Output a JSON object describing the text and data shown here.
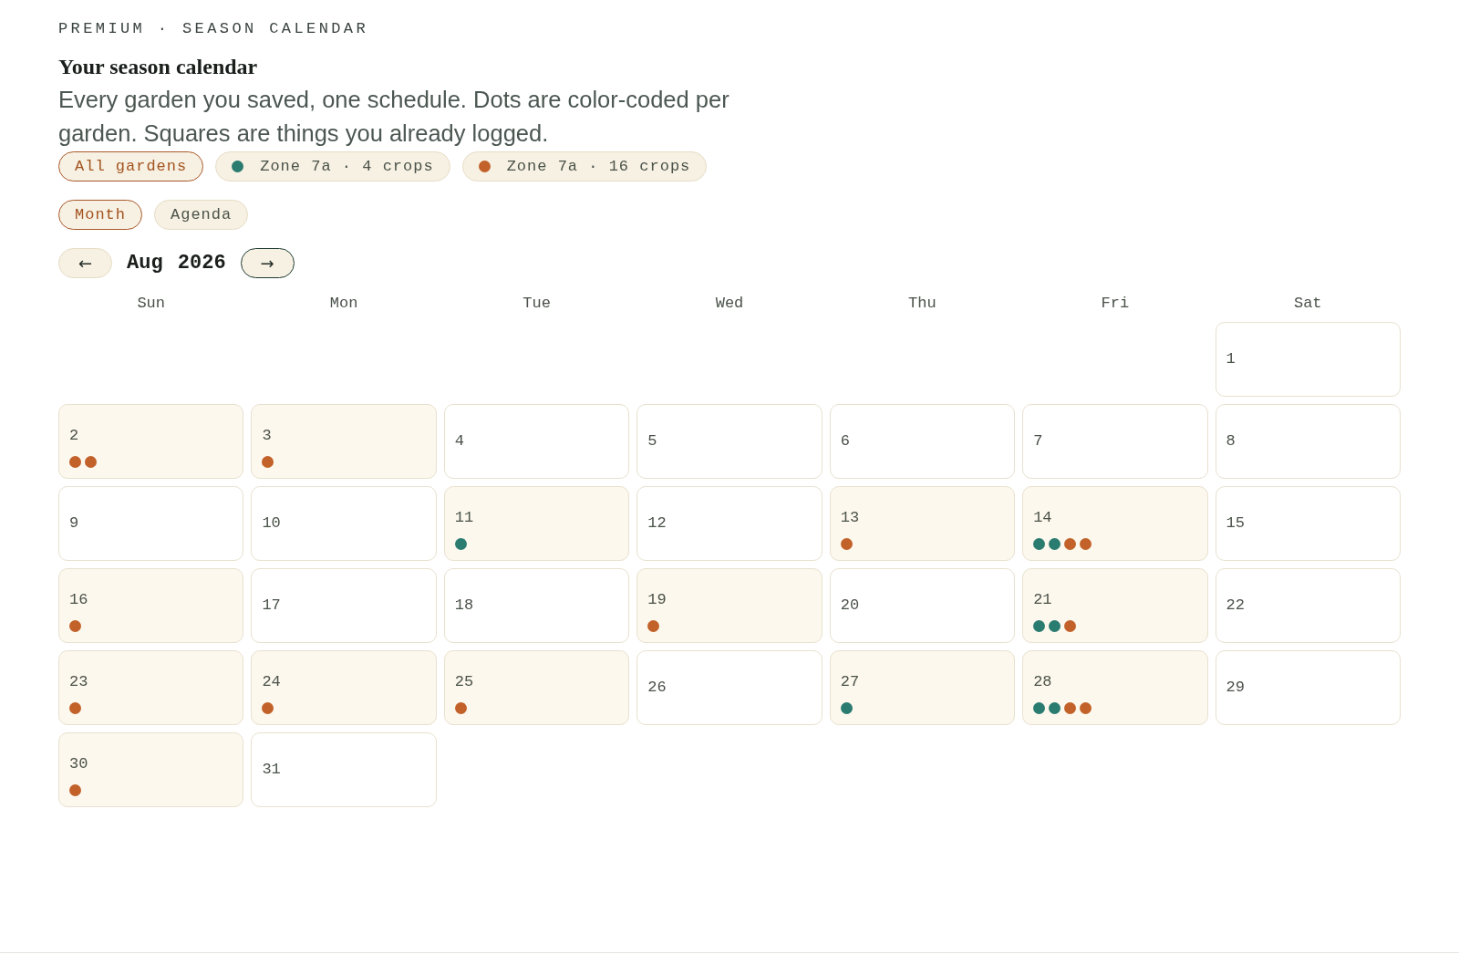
{
  "eyebrow": "PREMIUM · SEASON CALENDAR",
  "title": "Your season calendar",
  "description": "Every garden you saved, one schedule. Dots are color-coded per garden. Squares are things you already logged.",
  "garden_filters": [
    {
      "label": "All gardens",
      "selected": true
    },
    {
      "label": "Zone 7a · 4 crops",
      "selected": false,
      "color": "#2a7b70"
    },
    {
      "label": "Zone 7a · 16 crops",
      "selected": false,
      "color": "#c2622a"
    }
  ],
  "view_tabs": [
    {
      "label": "Month",
      "selected": true
    },
    {
      "label": "Agenda",
      "selected": false
    }
  ],
  "month_nav": {
    "prev": {
      "label": "←",
      "focused": false
    },
    "month": "Aug 2026",
    "next": {
      "label": "→",
      "focused": true
    }
  },
  "weekdays": [
    "Sun",
    "Mon",
    "Tue",
    "Wed",
    "Thu",
    "Fri",
    "Sat"
  ],
  "weeks": [
    {
      "days": [
        {
          "day": "1"
        }
      ]
    },
    {
      "days": [
        {
          "day": "2",
          "dots": [
            {
              "color": "#c2622a"
            },
            {
              "color": "#c2622a"
            }
          ]
        },
        {
          "day": "3",
          "dots": [
            {
              "color": "#c2622a"
            }
          ]
        },
        {
          "day": "4"
        },
        {
          "day": "5"
        },
        {
          "day": "6"
        },
        {
          "day": "7"
        },
        {
          "day": "8"
        }
      ]
    },
    {
      "days": [
        {
          "day": "9"
        },
        {
          "day": "10"
        },
        {
          "day": "11",
          "dots": [
            {
              "color": "#2a7b70"
            }
          ]
        },
        {
          "day": "12"
        },
        {
          "day": "13",
          "dots": [
            {
              "color": "#c2622a"
            }
          ]
        },
        {
          "day": "14",
          "dots": [
            {
              "color": "#2a7b70"
            },
            {
              "color": "#2a7b70"
            },
            {
              "color": "#c2622a"
            },
            {
              "color": "#c2622a"
            }
          ]
        },
        {
          "day": "15"
        }
      ]
    },
    {
      "days": [
        {
          "day": "16",
          "dots": [
            {
              "color": "#c2622a"
            }
          ]
        },
        {
          "day": "17"
        },
        {
          "day": "18"
        },
        {
          "day": "19",
          "dots": [
            {
              "color": "#c2622a"
            }
          ]
        },
        {
          "day": "20"
        },
        {
          "day": "21",
          "dots": [
            {
              "color": "#2a7b70"
            },
            {
              "color": "#2a7b70"
            },
            {
              "color": "#c2622a"
            }
          ]
        },
        {
          "day": "22"
        }
      ]
    },
    {
      "days": [
        {
          "day": "23",
          "dots": [
            {
              "color": "#c2622a"
            }
          ]
        },
        {
          "day": "24",
          "dots": [
            {
              "color": "#c2622a"
            }
          ]
        },
        {
          "day": "25",
          "dots": [
            {
              "color": "#c2622a"
            }
          ]
        },
        {
          "day": "26"
        },
        {
          "day": "27",
          "dots": [
            {
              "color": "#2a7b70"
            }
          ]
        },
        {
          "day": "28",
          "dots": [
            {
              "color": "#2a7b70"
            },
            {
              "color": "#2a7b70"
            },
            {
              "color": "#c2622a"
            },
            {
              "color": "#c2622a"
            }
          ]
        },
        {
          "day": "29"
        }
      ]
    },
    {
      "days": [
        {
          "day": "30",
          "dots": [
            {
              "color": "#c2622a"
            }
          ]
        },
        {
          "day": "31"
        }
      ]
    }
  ]
}
